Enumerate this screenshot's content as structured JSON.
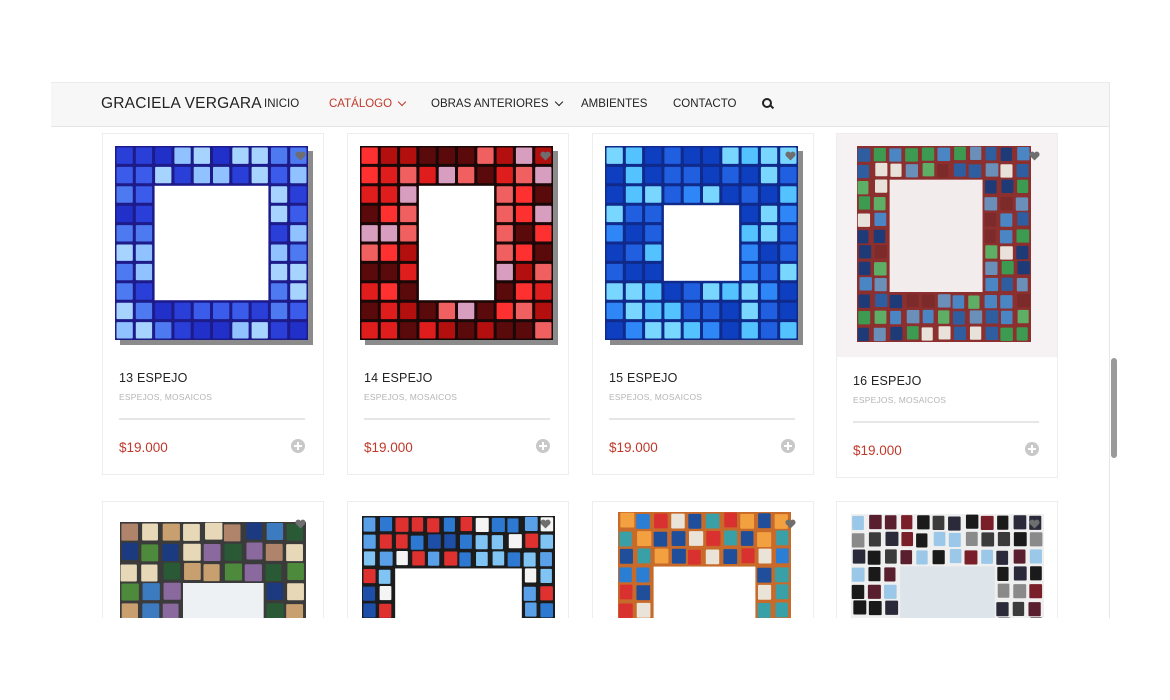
{
  "site": {
    "brand": "GRACIELA VERGARA"
  },
  "nav": {
    "items": [
      {
        "label": "INICIO",
        "active": false,
        "dropdown": false
      },
      {
        "label": "CATÁLOGO",
        "active": true,
        "dropdown": true
      },
      {
        "label": "OBRAS ANTERIORES",
        "active": false,
        "dropdown": true
      },
      {
        "label": "AMBIENTES",
        "active": false,
        "dropdown": false
      },
      {
        "label": "CONTACTO",
        "active": false,
        "dropdown": false
      }
    ],
    "search_icon": "search-icon"
  },
  "colors": {
    "accent": "#c0392b",
    "text": "#222222",
    "muted": "#b5b5b5"
  },
  "products": [
    {
      "title": "13 ESPEJO",
      "categories": "ESPEJOS, MOSAICOS",
      "price": "$19.000"
    },
    {
      "title": "14 ESPEJO",
      "categories": "ESPEJOS, MOSAICOS",
      "price": "$19.000"
    },
    {
      "title": "15 ESPEJO",
      "categories": "ESPEJOS, MOSAICOS",
      "price": "$19.000"
    },
    {
      "title": "16 ESPEJO",
      "categories": "ESPEJOS, MOSAICOS",
      "price": "$19.000"
    }
  ],
  "icons": {
    "wishlist": "heart-icon",
    "add_to_cart": "add-circle-icon"
  }
}
